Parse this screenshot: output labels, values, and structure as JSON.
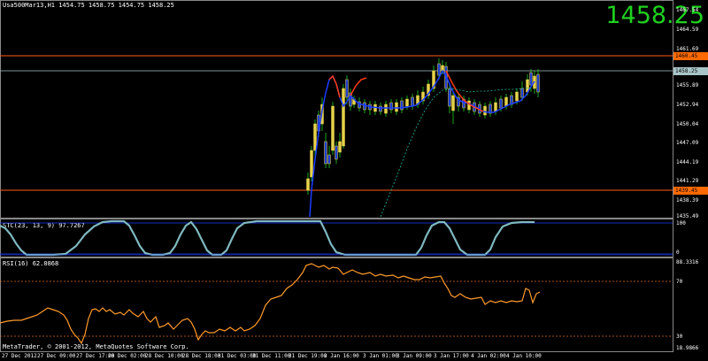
{
  "window": {
    "symbol_info": "Usa500Mar13,H1  1454.75 1458.75 1454.75 1458.25",
    "big_price": "1458.25"
  },
  "price_axis": {
    "ticks": [
      "1467.54",
      "1464.59",
      "1461.69",
      "1455.89",
      "1452.94",
      "1450.04",
      "1447.09",
      "1444.19",
      "1441.29",
      "1438.39",
      "1435.49"
    ],
    "tag_upper": "1460.45",
    "tag_bid": "1458.25",
    "tag_lower": "1439.45",
    "colors": {
      "tag_orange": "#ff6a00",
      "bid_line": "#a8c4c8",
      "hline": "#ff5a1a"
    }
  },
  "stc": {
    "label": "STC(23, 13, 9) 97.7267",
    "top_value": "100",
    "bottom_value": "0",
    "color": "#7fb8c0"
  },
  "rsi": {
    "label": "RSI(16) 62.0868",
    "top_value": "88.3316",
    "level_70": "70",
    "level_30": "30",
    "bottom_value": "18.9866",
    "color": "#ff9a2a"
  },
  "time_axis": [
    "27 Dec 2012",
    "27 Dec 09:00",
    "27 Dec 17:00",
    "28 Dec 02:00",
    "28 Dec 10:00",
    "28 Dec 18:00",
    "31 Dec 03:00",
    "31 Dec 11:00",
    "31 Dec 19:00",
    "2 Jan 16:00",
    "3 Jan 01:00",
    "3 Jan 09:00",
    "3 Jan 17:00",
    "4 Jan 02:00",
    "4 Jan 10:00"
  ],
  "footer": {
    "copyright": "MetaTrader, © 2001-2012, MetaQuotes Software Corp."
  }
}
